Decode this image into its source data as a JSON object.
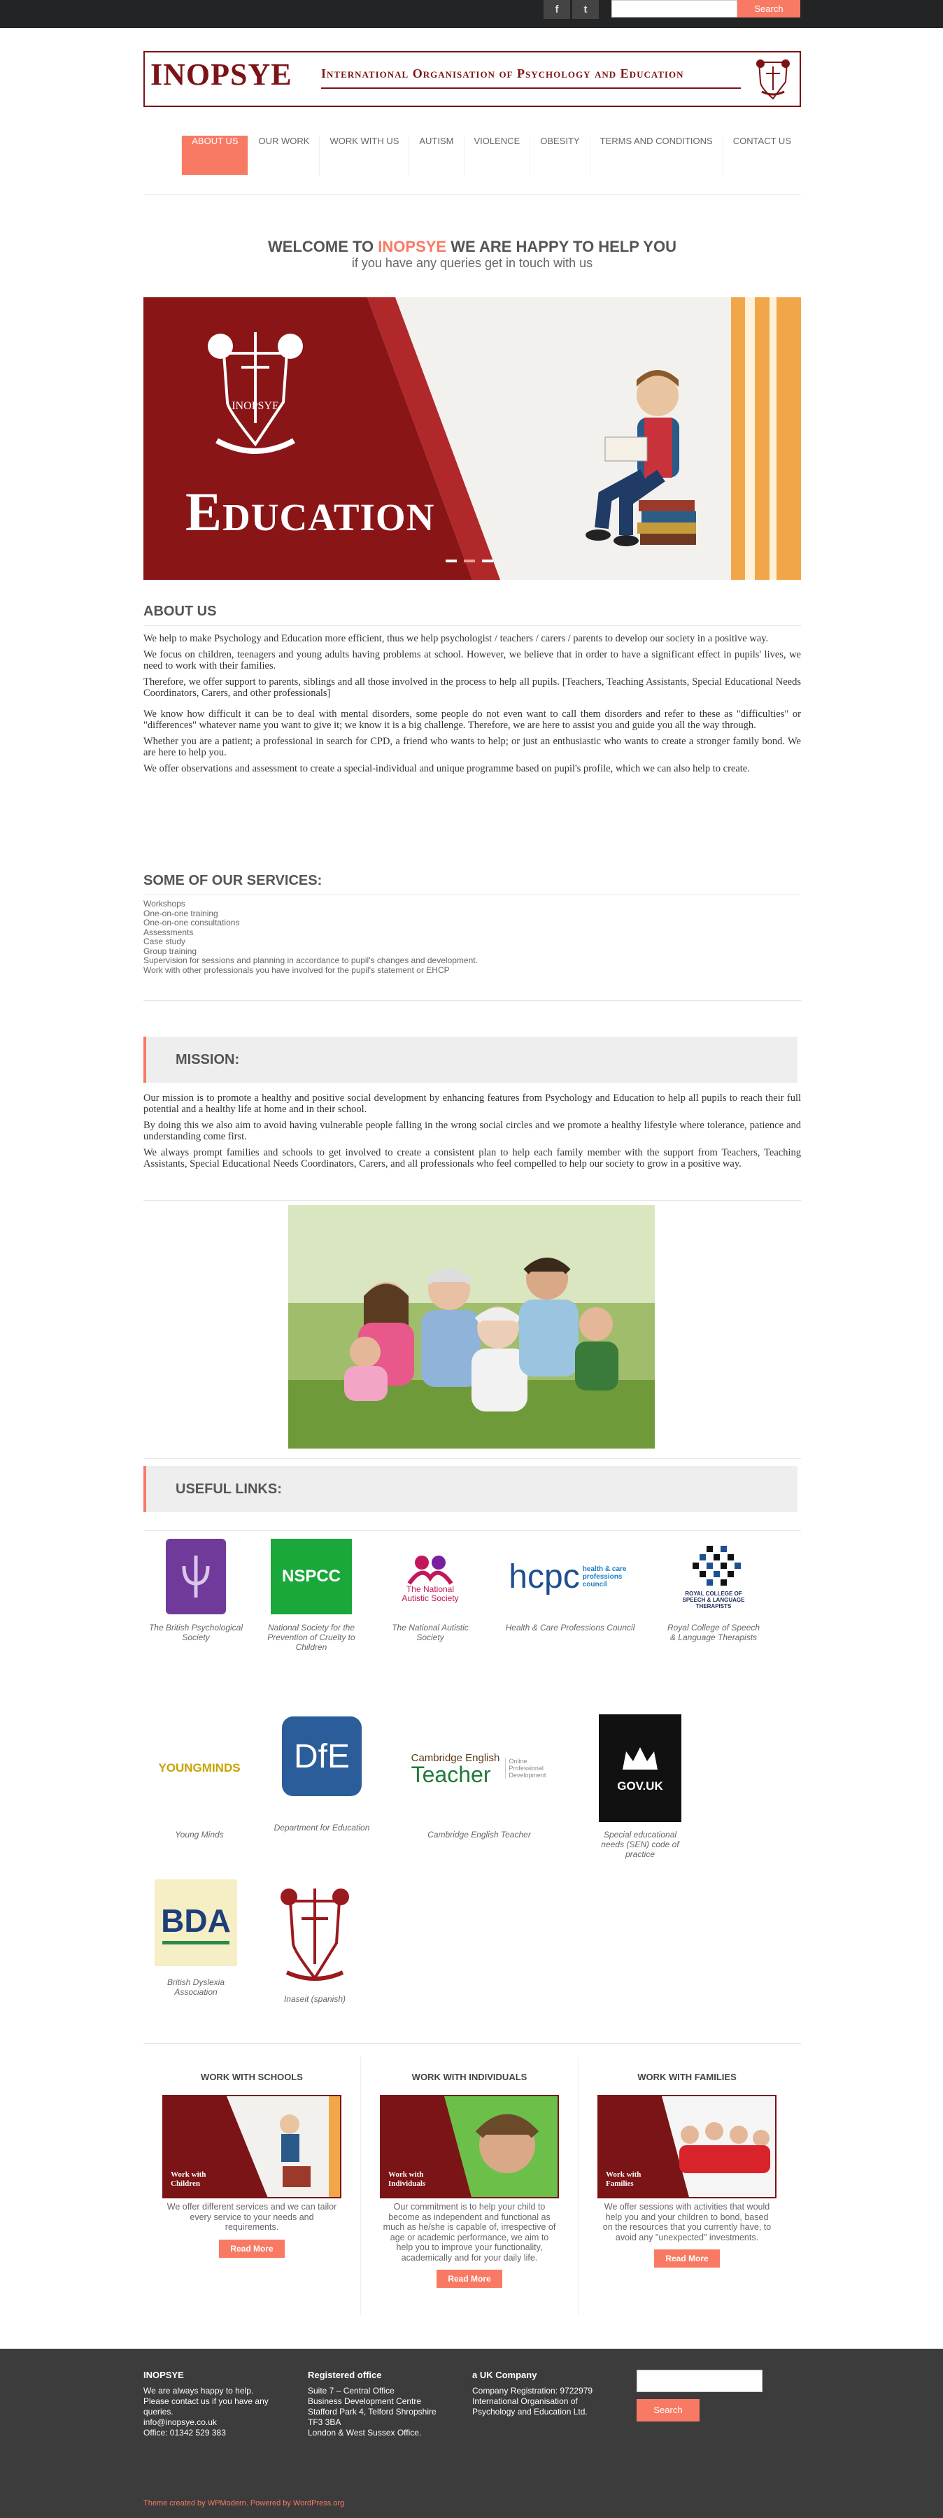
{
  "topbar": {
    "facebook": "f",
    "twitter": "t",
    "search_button": "Search"
  },
  "logo": {
    "brand": "INOPSYE",
    "tagline": "International Organisation of Psychology and Education"
  },
  "nav": [
    "ABOUT US",
    "OUR WORK",
    "WORK WITH US",
    "AUTISM",
    "VIOLENCE",
    "OBESITY",
    "TERMS AND CONDITIONS",
    "CONTACT US"
  ],
  "welcome": {
    "pre": "WELCOME TO ",
    "brand": "INOPSYE",
    "post": " WE ARE HAPPY TO HELP YOU",
    "sub": "if you have any queries get in touch with us"
  },
  "slider": {
    "caption": "Education",
    "crest_text": "INOPSYE"
  },
  "about": {
    "title": "ABOUT US",
    "paras": [
      "We help to make Psychology and Education more efficient, thus we help psychologist / teachers / carers / parents to develop our society in a positive way.",
      "We focus on children, teenagers and young adults having problems at school. However, we believe that in order to have a significant effect in pupils' lives, we need to work with their families.",
      "Therefore, we offer support to parents, siblings and all those involved in the process to help all pupils. [Teachers, Teaching Assistants, Special Educational Needs Coordinators, Carers, and other professionals]",
      "We know how difficult it can be to deal with mental disorders, some people do not even want to call them disorders and refer to these as \"difficulties\" or \"differences\" whatever name you want to give it; we know it is a big challenge. Therefore, we are here to assist you and guide you all the way through.",
      "Whether you are a patient; a professional in search for CPD, a friend who wants to help; or just an enthusiastic who wants to create a stronger family bond. We are here to help you.",
      "We offer observations and assessment to create a special-individual and unique programme based on pupil's profile, which we can also help to create."
    ]
  },
  "services": {
    "title": "SOME OF OUR SERVICES:",
    "items": [
      "Workshops",
      "One-on-one training",
      "One-on-one consultations",
      "Assessments",
      "Case study",
      "Group training",
      "Supervision for sessions and planning in accordance to pupil's changes and development.",
      "Work with other professionals you have involved for the pupil's statement or EHCP"
    ]
  },
  "mission": {
    "title": "MISSION:",
    "paras": [
      "Our mission is to promote a healthy and positive social development by enhancing features from Psychology and Education to help all pupils to reach their full potential and a healthy life at home and in their school.",
      "By doing this we also aim to avoid having vulnerable people falling in the wrong social circles and we promote a healthy lifestyle where tolerance, patience and understanding come first.",
      "We always prompt families and schools to get involved to create a consistent plan to help each family member with the support from Teachers, Teaching Assistants, Special Educational Needs Coordinators, Carers, and all professionals who feel compelled to help our society to grow in a positive way."
    ]
  },
  "links": {
    "title": "USEFUL LINKS:",
    "items": [
      {
        "label": "The British Psychological Society",
        "logo": ""
      },
      {
        "label": "National Society for the Prevention of Cruelty to Children",
        "logo": "NSPCC"
      },
      {
        "label": "The National Autistic Society",
        "logo": "The National Autistic Society"
      },
      {
        "label": "Health & Care Professions Council",
        "logo": "hcpc",
        "logo_sub": "health & care professions council"
      },
      {
        "label": "Royal College of Speech & Language Therapists",
        "logo": "ROYAL COLLEGE OF SPEECH & LANGUAGE THERAPISTS"
      },
      {
        "label": "Young Minds",
        "logo": "YOUNGMINDS"
      },
      {
        "label": "Department for Education",
        "logo": "DfE"
      },
      {
        "label": "Cambridge English Teacher",
        "logo": "Cambridge English",
        "logo_sub": "Teacher",
        "logo_side": "Online Professional Development"
      },
      {
        "label": "Special educational needs (SEN) code of practice",
        "logo": "GOV.UK"
      },
      {
        "label": "British Dyslexia Association",
        "logo": "BDA"
      },
      {
        "label": "Inaseit (spanish)",
        "logo": ""
      }
    ]
  },
  "work": [
    {
      "title": "WORK WITH SCHOOLS",
      "img": "Work with Children",
      "text": "We offer different services and we can tailor every service to your needs and requirements.",
      "btn": "Read More"
    },
    {
      "title": "WORK WITH INDIVIDUALS",
      "img": "Work with Individuals",
      "text": "Our commitment is to help your child to become as independent and functional as much as he/she is capable of, irrespective of age or academic performance, we aim to help you to improve your functionality, academically and for your daily life.",
      "btn": "Read More"
    },
    {
      "title": "WORK WITH FAMILIES",
      "img": "Work with Families",
      "text": "We offer sessions with activities that would help you and your children to bond, based on the resources that you currently have, to avoid any \"unexpected\" investments.",
      "btn": "Read More"
    }
  ],
  "footer": {
    "c1": {
      "title": "INOPSYE",
      "lines": [
        "We are always happy to help.",
        "Please contact us if you have any",
        "queries.",
        "info@inopsye.co.uk",
        "Office: 01342 529 383"
      ]
    },
    "c2": {
      "title": "Registered office",
      "lines": [
        "Suite 7 – Central Office",
        "Business Development Centre",
        "Stafford Park 4, Telford Shropshire",
        "TF3 3BA",
        "London & West Sussex Office."
      ]
    },
    "c3": {
      "title": "a UK Company",
      "lines": [
        "Company Registration: 9722979",
        "International Organisation of",
        "Psychology and Education Ltd."
      ]
    },
    "search_button": "Search",
    "credit": "Theme created by WPModern. Powered by WordPress.org"
  },
  "colors": {
    "accent": "#f97a64",
    "brand": "#7b1416",
    "footer": "#3c3c3c"
  }
}
